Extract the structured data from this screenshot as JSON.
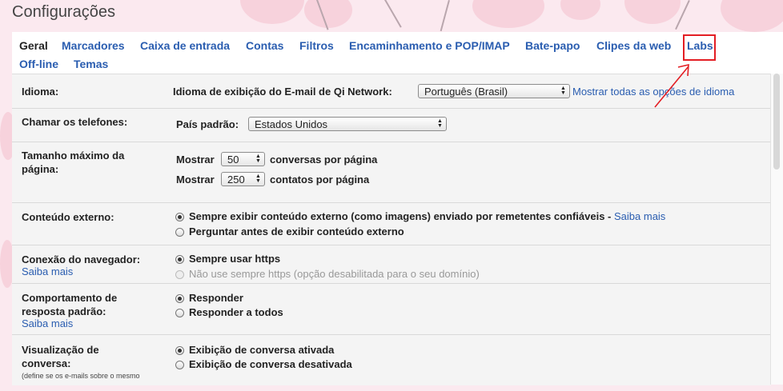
{
  "page_title": "Configurações",
  "tabs": [
    {
      "label": "Geral",
      "active": true
    },
    {
      "label": "Marcadores"
    },
    {
      "label": "Caixa de entrada"
    },
    {
      "label": "Contas"
    },
    {
      "label": "Filtros"
    },
    {
      "label": "Encaminhamento e POP/IMAP"
    },
    {
      "label": "Bate-papo"
    },
    {
      "label": "Clipes da web"
    },
    {
      "label": "Labs"
    },
    {
      "label": "Off-line"
    },
    {
      "label": "Temas"
    }
  ],
  "colors": {
    "link": "#2a5db0",
    "highlight_box": "#e31e24",
    "background": "#fbe9ef"
  },
  "settings": {
    "idioma": {
      "label": "Idioma:",
      "text": "Idioma de exibição do E-mail de Qi Network:",
      "selected": "Português (Brasil)",
      "link": "Mostrar todas as opções de idioma"
    },
    "telefones": {
      "label": "Chamar os telefones:",
      "text": "País padrão:",
      "selected": "Estados Unidos"
    },
    "tamanho": {
      "label": "Tamanho máximo da página:",
      "show1": "Mostrar",
      "value1": "50",
      "suffix1": "conversas por página",
      "show2": "Mostrar",
      "value2": "250",
      "suffix2": "contatos por página"
    },
    "conteudo": {
      "label": "Conteúdo externo:",
      "opt1": "Sempre exibir conteúdo externo (como imagens) enviado por remetentes confiáveis -",
      "opt1_link": "Saiba mais",
      "opt2": "Perguntar antes de exibir conteúdo externo"
    },
    "conexao": {
      "label": "Conexão do navegador:",
      "learn_more": "Saiba mais",
      "opt1": "Sempre usar https",
      "opt2": "Não use sempre https (opção desabilitada para o seu domínio)"
    },
    "resposta": {
      "label": "Comportamento de resposta padrão:",
      "learn_more": "Saiba mais",
      "opt1": "Responder",
      "opt2": "Responder a todos"
    },
    "visualizacao": {
      "label": "Visualização de conversa:",
      "note": "(define se os e-mails sobre o mesmo",
      "opt1": "Exibição de conversa ativada",
      "opt2": "Exibição de conversa desativada"
    }
  }
}
